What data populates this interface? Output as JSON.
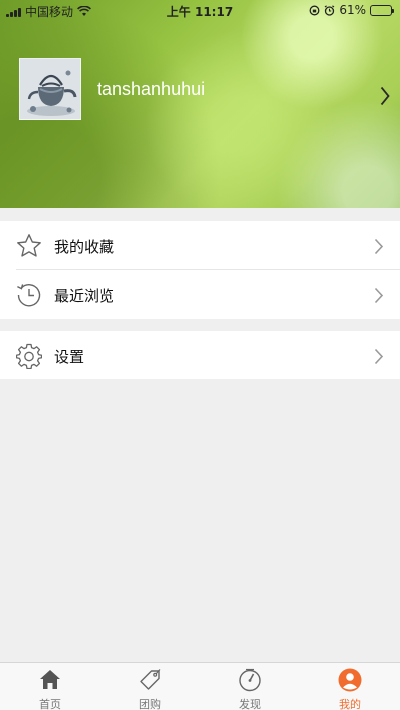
{
  "status_bar": {
    "carrier": "中国移动",
    "time": "上午 11:17",
    "battery_text": "61%",
    "battery_level": 0.61
  },
  "profile": {
    "username": "tanshanhuhui"
  },
  "menu": {
    "favorites_label": "我的收藏",
    "recent_label": "最近浏览",
    "settings_label": "设置"
  },
  "tabbar": {
    "tabs": [
      {
        "label": "首页",
        "icon": "home-icon"
      },
      {
        "label": "团购",
        "icon": "tag-icon"
      },
      {
        "label": "发现",
        "icon": "compass-icon"
      },
      {
        "label": "我的",
        "icon": "user-icon"
      }
    ],
    "active_index": 3,
    "active_color": "#f06d2f",
    "inactive_color": "#777777"
  }
}
